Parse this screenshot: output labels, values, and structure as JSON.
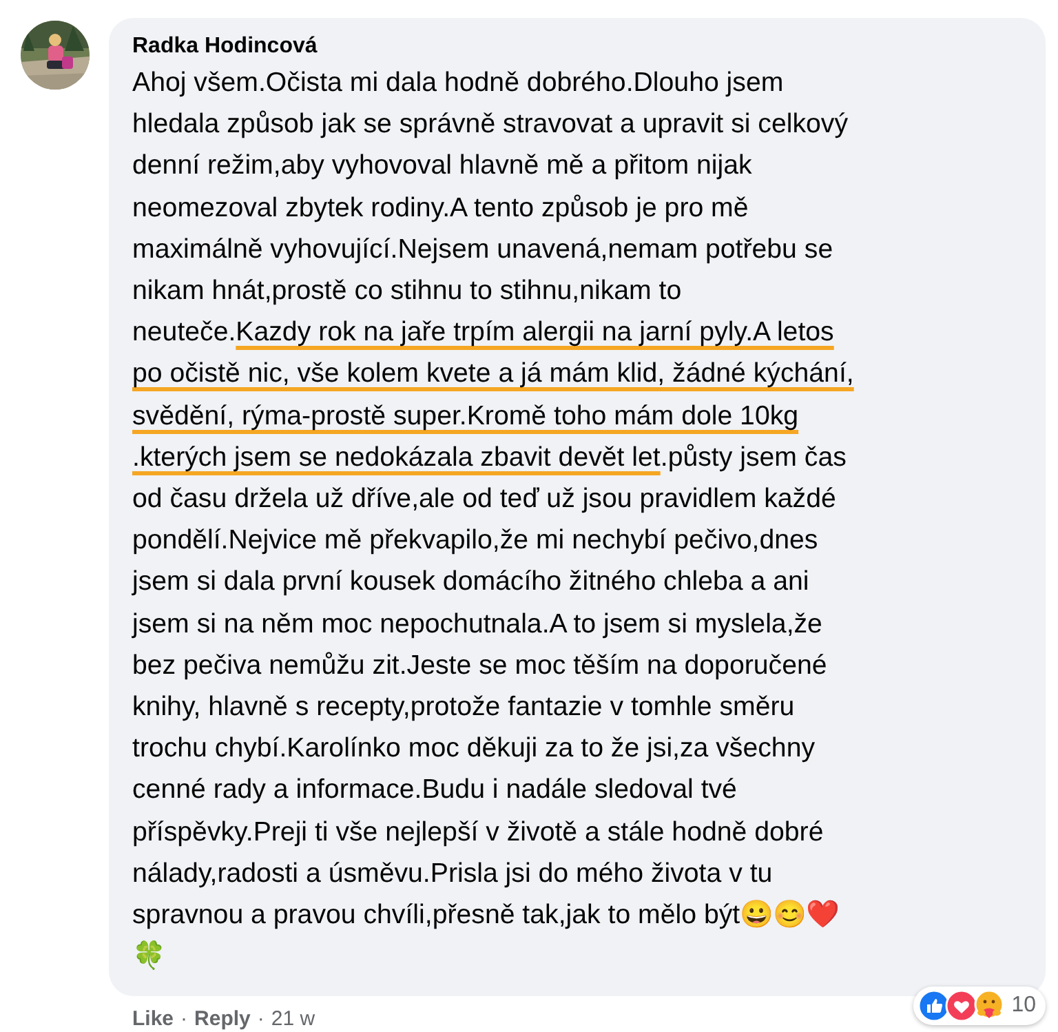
{
  "comment": {
    "author": "Radka Hodincová",
    "body": [
      {
        "text": "Ahoj všem.Očista mi dala hodně dobrého.Dlouho jsem\nhledala způsob jak se správně stravovat a upravit si celkový\ndenní režim,aby vyhovoval hlavně mě a přitom nijak\nneomezoval zbytek rodiny.A tento způsob je pro mě\nmaximálně vyhovující.Nejsem unavená,nemam potřebu se\nnikam hnát,prostě co stihnu to stihnu,nikam to\nneuteče.",
        "underlined": false
      },
      {
        "text": "Kazdy rok na jaře trpím alergii na jarní pyly.A letos\npo očistě nic, vše kolem kvete a já mám klid, žádné kýchání,\nsvědění, rýma-prostě super.Kromě toho mám dole 10kg\n.kterých jsem se nedokázala zbavit devět let",
        "underlined": true
      },
      {
        "text": ".půsty jsem čas\nod času držela už dříve,ale od teď už jsou pravidlem každé\npondělí.Nejvice mě překvapilo,že mi nechybí pečivo,dnes\njsem si dala první kousek domácího žitného chleba a ani\njsem si na něm moc nepochutnala.A to jsem si myslela,že\nbez pečiva nemůžu zit.Jeste se moc těším na doporučené\nknihy, hlavně s recepty,protože fantazie v tomhle směru\ntrochu chybí.Karolínko moc děkuji za to že jsi,za všechny\ncenné rady a informace.Budu i nadále sledoval tvé\npříspěvky.Preji ti vše nejlepší v životě a stále hodně dobré\nnálady,radosti a úsměvu.Prisla jsi do mého života v tu\nspravnou a pravou chvíli,přesně tak,jak to mělo být😀😊❤️\n🍀",
        "underlined": false
      }
    ],
    "footer": [
      {
        "kind": "link",
        "text": "Like"
      },
      {
        "kind": "separator",
        "text": "·"
      },
      {
        "kind": "link",
        "text": "Reply"
      },
      {
        "kind": "separator",
        "text": "·"
      },
      {
        "kind": "time",
        "text": "21 w"
      }
    ],
    "reactions": {
      "icons": [
        {
          "kind": "like"
        },
        {
          "kind": "love"
        },
        {
          "kind": "care"
        }
      ],
      "count": "10"
    }
  }
}
